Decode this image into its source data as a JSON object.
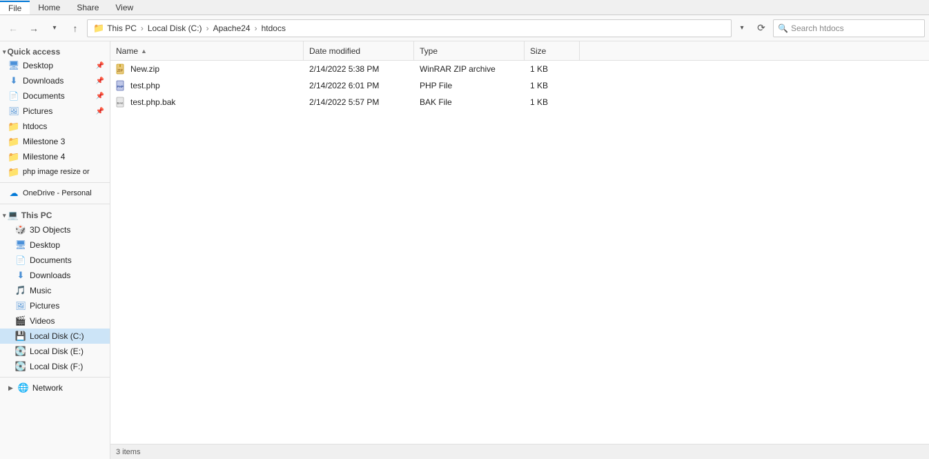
{
  "ribbon": {
    "tabs": [
      "File",
      "Home",
      "Share",
      "View"
    ],
    "active_tab": "File"
  },
  "addressbar": {
    "back_label": "←",
    "forward_label": "→",
    "up_label": "↑",
    "recent_label": "▾",
    "breadcrumb": [
      "This PC",
      "Local Disk (C:)",
      "Apache24",
      "htdocs"
    ],
    "search_placeholder": "Search htdocs",
    "refresh_label": "⟳"
  },
  "sidebar": {
    "quick_access_label": "Quick access",
    "items_quick": [
      {
        "label": "Desktop",
        "icon": "desktop-icon",
        "pinned": true
      },
      {
        "label": "Downloads",
        "icon": "downloads-icon",
        "pinned": true
      },
      {
        "label": "Documents",
        "icon": "documents-icon",
        "pinned": true
      },
      {
        "label": "Pictures",
        "icon": "pictures-icon",
        "pinned": true
      },
      {
        "label": "htdocs",
        "icon": "folder-icon",
        "pinned": false
      },
      {
        "label": "Milestone 3",
        "icon": "folder-icon",
        "pinned": false
      },
      {
        "label": "Milestone 4",
        "icon": "folder-icon",
        "pinned": false
      },
      {
        "label": "php image resize or",
        "icon": "folder-icon",
        "pinned": false
      }
    ],
    "onedrive_label": "OneDrive - Personal",
    "thispc_label": "This PC",
    "items_thispc": [
      {
        "label": "3D Objects",
        "icon": "3d-icon"
      },
      {
        "label": "Desktop",
        "icon": "desktop-icon"
      },
      {
        "label": "Documents",
        "icon": "documents-icon"
      },
      {
        "label": "Downloads",
        "icon": "downloads-icon"
      },
      {
        "label": "Music",
        "icon": "music-icon"
      },
      {
        "label": "Pictures",
        "icon": "pictures-icon"
      },
      {
        "label": "Videos",
        "icon": "videos-icon"
      },
      {
        "label": "Local Disk (C:)",
        "icon": "drive-c-icon",
        "active": true
      },
      {
        "label": "Local Disk (E:)",
        "icon": "drive-icon"
      },
      {
        "label": "Local Disk (F:)",
        "icon": "drive-icon"
      }
    ],
    "network_label": "Network"
  },
  "columns": [
    {
      "label": "Name",
      "key": "name",
      "sort": "asc"
    },
    {
      "label": "Date modified",
      "key": "date"
    },
    {
      "label": "Type",
      "key": "type"
    },
    {
      "label": "Size",
      "key": "size"
    }
  ],
  "files": [
    {
      "name": "New.zip",
      "icon": "zip-icon",
      "date": "2/14/2022 5:38 PM",
      "type": "WinRAR ZIP archive",
      "size": "1 KB"
    },
    {
      "name": "test.php",
      "icon": "php-icon",
      "date": "2/14/2022 6:01 PM",
      "type": "PHP File",
      "size": "1 KB"
    },
    {
      "name": "test.php.bak",
      "icon": "bak-icon",
      "date": "2/14/2022 5:57 PM",
      "type": "BAK File",
      "size": "1 KB"
    }
  ],
  "status": {
    "text": "3 items"
  }
}
